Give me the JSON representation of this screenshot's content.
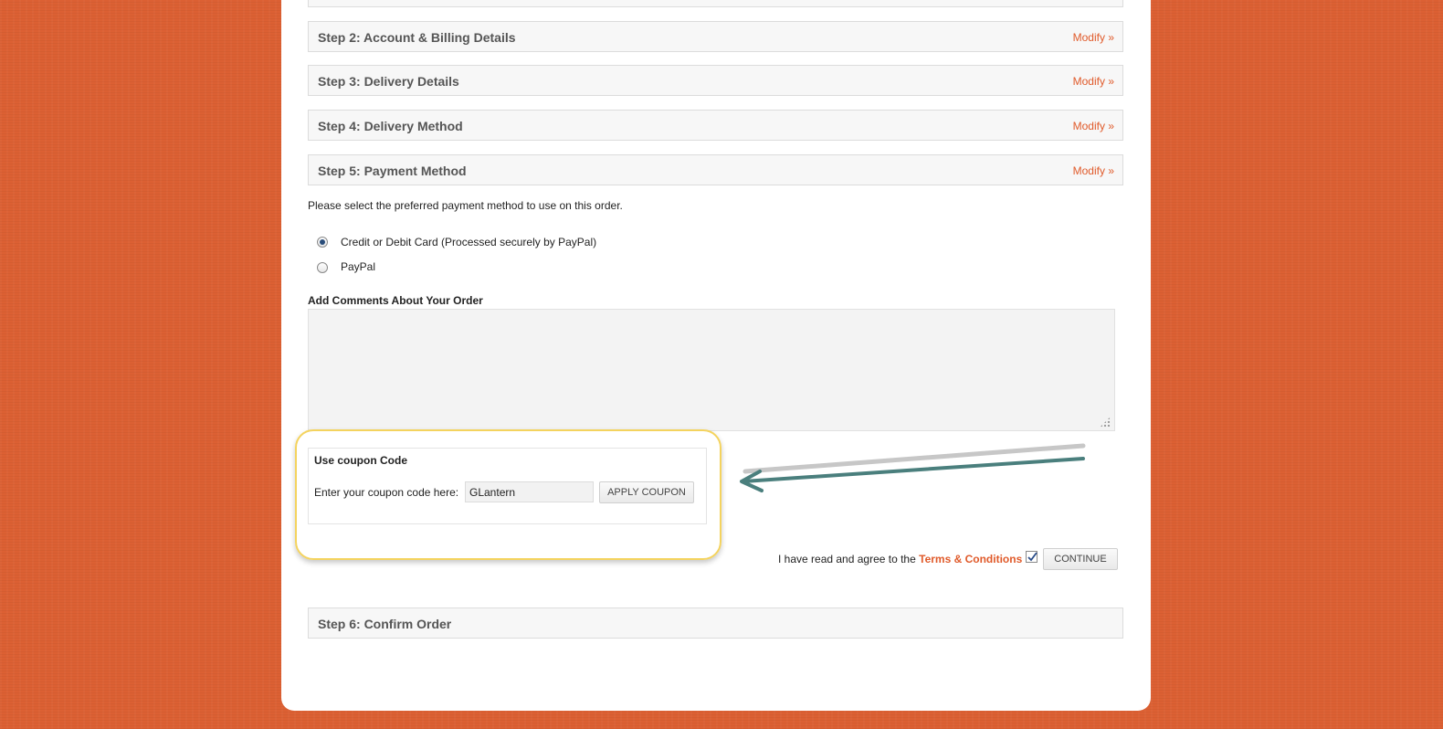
{
  "steps": {
    "step2": {
      "title": "Step 2: Account & Billing Details",
      "modify": "Modify »"
    },
    "step3": {
      "title": "Step 3: Delivery Details",
      "modify": "Modify »"
    },
    "step4": {
      "title": "Step 4: Delivery Method",
      "modify": "Modify »"
    },
    "step5": {
      "title": "Step 5: Payment Method",
      "modify": "Modify »"
    },
    "step6": {
      "title": "Step 6: Confirm Order"
    }
  },
  "payment": {
    "instruction": "Please select the preferred payment method to use on this order.",
    "options": [
      {
        "label": "Credit or Debit Card (Processed securely by PayPal)",
        "selected": true
      },
      {
        "label": "PayPal",
        "selected": false
      }
    ]
  },
  "comments": {
    "heading": "Add Comments About Your Order",
    "value": ""
  },
  "coupon": {
    "heading": "Use coupon Code",
    "label": "Enter your coupon code here:",
    "value": "GLantern",
    "button": "APPLY COUPON"
  },
  "agreement": {
    "text": "I have read and agree to the",
    "link": "Terms & Conditions",
    "checked": true,
    "continue": "CONTINUE"
  },
  "colors": {
    "background": "#dc6033",
    "link": "#e05a2a",
    "highlight": "#f4d35e",
    "arrow": "#4a7f7d"
  },
  "icons": {
    "arrow": "left-arrow-annotation",
    "check": "checkmark"
  }
}
